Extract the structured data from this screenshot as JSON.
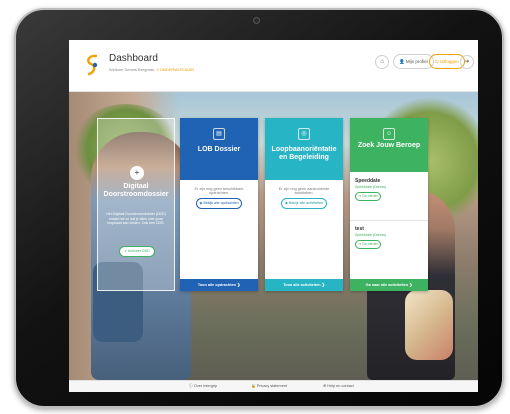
{
  "header": {
    "title": "Dashboard",
    "subtitle_prefix": "Welkom Dennis Bergman,",
    "subtitle_highlight": "2 ONDERWIJSJAAR",
    "home_icon": "home-icon",
    "profile_label": "Mijn profiel",
    "logout_label": "Uitloggen",
    "forward_icon": "arrow-right-icon"
  },
  "digital": {
    "title": "Digitaal Doorstroomdossier",
    "description": "Het Digitaal Doorstroomdossier (DDD) maakt het zo dat je alles over jouw loopbaan kan vinden. Ook een DDD.",
    "button_label": "Activeer DDD"
  },
  "cards": {
    "lob": {
      "title": "LOB Dossier",
      "body": "Er zijn nog geen beschikbare opdrachten.",
      "button_label": "Bekijk alle opdrachten",
      "footer": "Toon alle opdrachten"
    },
    "loopbaan": {
      "title": "Loopbaanoriëntatie en Begeleiding",
      "body": "Er zijn nog geen aankomende activiteiten.",
      "button_label": "Bekijk alle activiteiten",
      "footer": "Toon alle activiteiten"
    },
    "beroep": {
      "title": "Zoek Jouw Beroep",
      "jobs": [
        {
          "name": "Speeddate",
          "sub": "Speeddate (Dennis)",
          "button_label": "Ga verder"
        },
        {
          "name": "test",
          "sub": "Speeddate (Dennis)",
          "button_label": "Ga verder"
        }
      ],
      "footer": "Ga naar alle activiteiten"
    }
  },
  "footer": {
    "links": [
      "Over Intergrip",
      "Privacy statement",
      "Help en contact"
    ]
  },
  "colors": {
    "blue": "#2062b4",
    "teal": "#27b4c4",
    "green": "#3db261",
    "orange": "#f0a000"
  }
}
